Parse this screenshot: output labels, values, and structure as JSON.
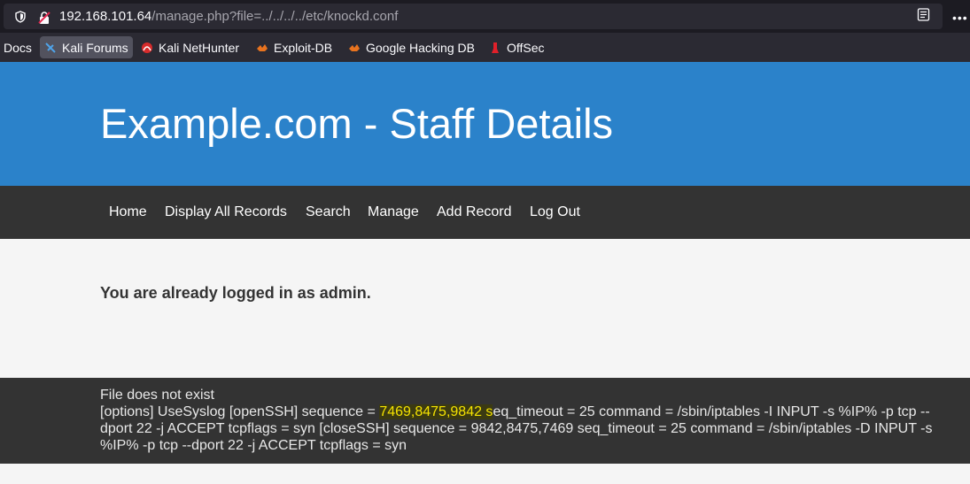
{
  "browser": {
    "url_host": "192.168.101.64",
    "url_path": "/manage.php?file=../../../../etc/knockd.conf",
    "bookmarks": [
      "Docs",
      "Kali Forums",
      "Kali NetHunter",
      "Exploit-DB",
      "Google Hacking DB",
      "OffSec"
    ]
  },
  "page": {
    "title": "Example.com - Staff Details",
    "nav": [
      "Home",
      "Display All Records",
      "Search",
      "Manage",
      "Add Record",
      "Log Out"
    ],
    "logged_message": "You are already logged in as admin.",
    "footer": {
      "line1": "File does not exist",
      "pre": "[options] UseSyslog [openSSH] sequence = ",
      "highlight": "7469,8475,9842 s",
      "post": "eq_timeout = 25 command = /sbin/iptables -I INPUT -s %IP% -p tcp --dport 22 -j ACCEPT tcpflags = syn [closeSSH] sequence = 9842,8475,7469 seq_timeout = 25 command = /sbin/iptables -D INPUT -s %IP% -p tcp --dport 22 -j ACCEPT tcpflags = syn"
    }
  },
  "colors": {
    "hero": "#2b82ca",
    "nav": "#333333",
    "highlight": "#f5e300"
  }
}
